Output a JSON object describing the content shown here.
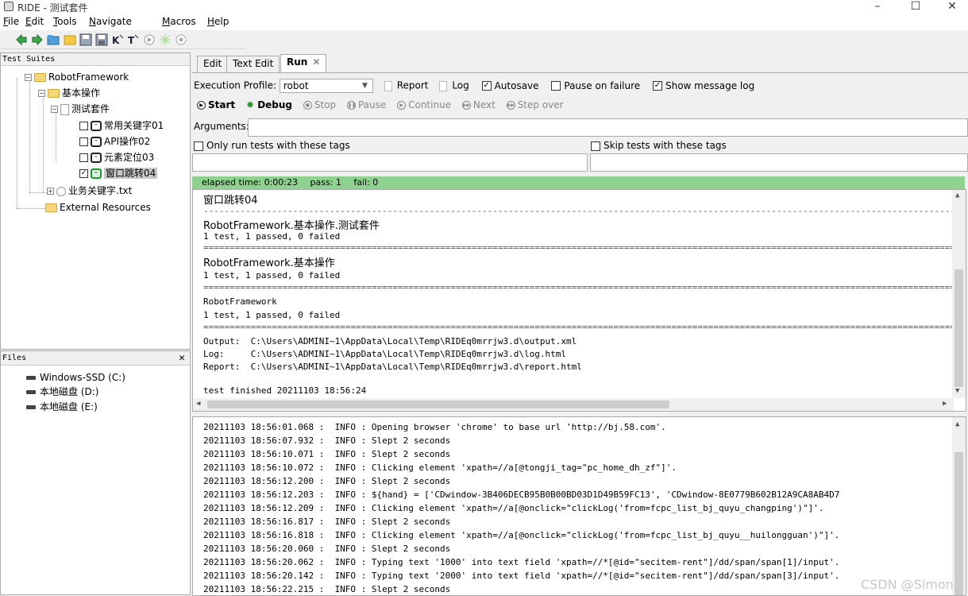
{
  "window": {
    "title": "RIDE - 测试套件",
    "minimize": "–",
    "maximize": "☐",
    "close": "✕"
  },
  "menu": [
    "File",
    "Edit",
    "Tools",
    "Navigate",
    "Macros",
    "Help"
  ],
  "menu_accel": [
    "F",
    "E",
    "T",
    "N",
    "M",
    "H"
  ],
  "menu_rest": [
    "ile",
    "dit",
    "ools",
    "avigate",
    "acros",
    "elp"
  ],
  "tree": {
    "header": "Test Suites",
    "root": "RobotFramework",
    "level1": "基本操作",
    "level2": "测试套件",
    "tests": [
      "常用关键字01",
      "API操作02",
      "元素定位03",
      "窗口跳转04"
    ],
    "resource_file": "业务关键字.txt",
    "external": "External Resources"
  },
  "files": {
    "header": "Files",
    "close": "✕",
    "drives": [
      "Windows-SSD (C:)",
      "本地磁盘 (D:)",
      "本地磁盘 (E:)"
    ]
  },
  "tabs": [
    "Edit",
    "Text Edit",
    "Run"
  ],
  "tab_close": "✕",
  "run": {
    "profile_label": "Execution Profile:",
    "profile_value": "robot",
    "report": "Report",
    "log": "Log",
    "autosave": "Autosave",
    "pause_on_failure": "Pause on failure",
    "show_message_log": "Show message log",
    "controls": [
      "Start",
      "Debug",
      "Stop",
      "Pause",
      "Continue",
      "Next",
      "Step over"
    ],
    "arguments_label": "Arguments:",
    "only_run_tags": "Only run tests with these tags",
    "skip_tags": "Skip tests with these tags"
  },
  "status": {
    "elapsed": "elapsed time: 0:00:23",
    "pass": "pass: 1",
    "fail": "fail: 0"
  },
  "output": [
    "窗口跳转04",
    "------------------------------------------------------------------------------------------------------------------------------------------------------------------",
    "RobotFramework.基本操作.测试套件",
    "1 test, 1 passed, 0 failed",
    "==================================================================================================================================================================",
    "RobotFramework.基本操作",
    "1 test, 1 passed, 0 failed",
    "==================================================================================================================================================================",
    "RobotFramework",
    "1 test, 1 passed, 0 failed",
    "==================================================================================================================================================================",
    "Output:  C:\\Users\\ADMINI~1\\AppData\\Local\\Temp\\RIDEq0mrrjw3.d\\output.xml",
    "Log:     C:\\Users\\ADMINI~1\\AppData\\Local\\Temp\\RIDEq0mrrjw3.d\\log.html",
    "Report:  C:\\Users\\ADMINI~1\\AppData\\Local\\Temp\\RIDEq0mrrjw3.d\\report.html",
    "",
    "test finished 20211103 18:56:24"
  ],
  "log": [
    "20211103 18:56:01.068 :  INFO : Opening browser 'chrome' to base url 'http://bj.58.com'.",
    "20211103 18:56:07.932 :  INFO : Slept 2 seconds",
    "20211103 18:56:10.071 :  INFO : Slept 2 seconds",
    "20211103 18:56:10.072 :  INFO : Clicking element 'xpath=//a[@tongji_tag=\"pc_home_dh_zf\"]'.",
    "20211103 18:56:12.200 :  INFO : Slept 2 seconds",
    "20211103 18:56:12.203 :  INFO : ${hand} = ['CDwindow-3B406DECB95B0B00BD03D1D49B59FC13', 'CDwindow-8E0779B602B12A9CA8AB4D7",
    "20211103 18:56:12.209 :  INFO : Clicking element 'xpath=//a[@onclick=\"clickLog('from=fcpc_list_bj_quyu_changping')\"]'.",
    "20211103 18:56:16.817 :  INFO : Slept 2 seconds",
    "20211103 18:56:16.818 :  INFO : Clicking element 'xpath=//a[@onclick=\"clickLog('from=fcpc_list_bj_quyu__huilongguan')\"]'.",
    "20211103 18:56:20.060 :  INFO : Slept 2 seconds",
    "20211103 18:56:20.062 :  INFO : Typing text '1000' into text field 'xpath=//*[@id=\"secitem-rent\"]/dd/span/span[1]/input'.",
    "20211103 18:56:20.142 :  INFO : Typing text '2000' into text field 'xpath=//*[@id=\"secitem-rent\"]/dd/span/span[3]/input'.",
    "20211103 18:56:22.215 :  INFO : Slept 2 seconds"
  ],
  "watermark": "CSDN @Simon.,"
}
